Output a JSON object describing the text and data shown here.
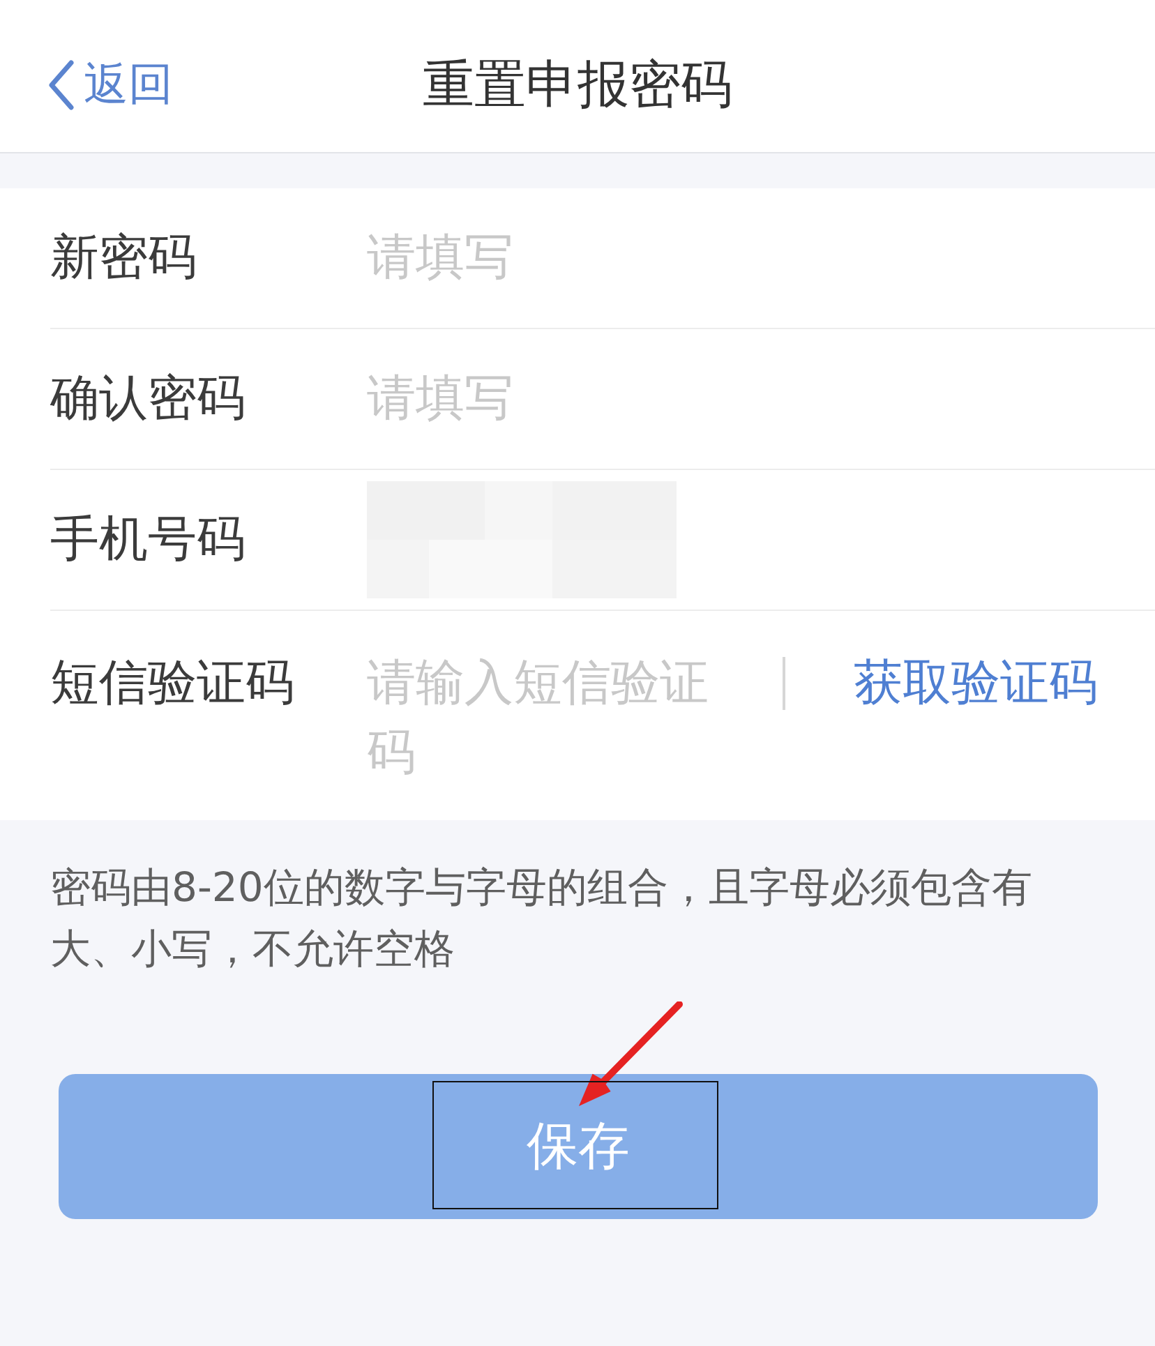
{
  "header": {
    "back": "返回",
    "title": "重置申报密码"
  },
  "form": {
    "rows": [
      {
        "kind": "text",
        "label": "新密码",
        "placeholder": "请填写"
      },
      {
        "kind": "text",
        "label": "确认密码",
        "placeholder": "请填写"
      },
      {
        "kind": "masked",
        "label": "手机号码"
      },
      {
        "kind": "code",
        "label": "短信验证码",
        "placeholder": "请输入短信验证码",
        "action": "获取验证码"
      }
    ]
  },
  "hint": "密码由8-20位的数字与字母的组合，且字母必须包含有大、小写，不允许空格",
  "save_button": {
    "label": "保存",
    "disabled": true
  },
  "annotations": [
    {
      "kind": "arrow"
    },
    {
      "kind": "highlight-box"
    }
  ]
}
